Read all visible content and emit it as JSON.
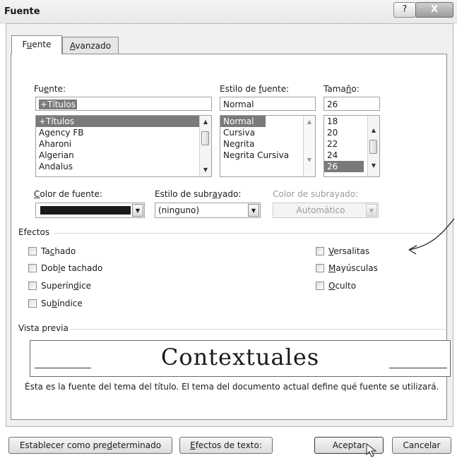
{
  "window": {
    "title": "Fuente",
    "help_label": "?",
    "close_label": "X"
  },
  "tabs": [
    {
      "label_pre": "F",
      "label_u": "u",
      "label_post": "ente"
    },
    {
      "label_pre": "",
      "label_u": "A",
      "label_post": "vanzado"
    }
  ],
  "font": {
    "label_pre": "Fu",
    "label_u": "e",
    "label_post": "nte:",
    "value": "+Títulos",
    "list": [
      "+Títulos",
      "Agency FB",
      "Aharoni",
      "Algerian",
      "Andalus"
    ]
  },
  "style": {
    "label_pre": "Estilo de ",
    "label_u": "f",
    "label_post": "uente:",
    "value": "Normal",
    "list": [
      "Normal",
      "Cursiva",
      "Negrita",
      "Negrita Cursiva"
    ]
  },
  "size": {
    "label_pre": "Tama",
    "label_u": "ñ",
    "label_post": "o:",
    "value": "26",
    "list": [
      "18",
      "20",
      "22",
      "24",
      "26"
    ]
  },
  "font_color": {
    "label_pre": "",
    "label_u": "C",
    "label_post": "olor de fuente:",
    "color": "#1a1a1a"
  },
  "underline_style": {
    "label_pre": "Estilo de subr",
    "label_u": "a",
    "label_post": "yado:",
    "value": "(ninguno)"
  },
  "underline_color": {
    "label": "Color de subrayado:",
    "value": "Automático"
  },
  "effects": {
    "title": "Efectos",
    "left": [
      {
        "pre": "Ta",
        "u": "c",
        "post": "hado"
      },
      {
        "pre": "Dob",
        "u": "l",
        "post": "e tachado"
      },
      {
        "pre": "Superín",
        "u": "d",
        "post": "ice"
      },
      {
        "pre": "Su",
        "u": "b",
        "post": "índice"
      }
    ],
    "right": [
      {
        "pre": "",
        "u": "V",
        "post": "ersalitas"
      },
      {
        "pre": "",
        "u": "M",
        "post": "ayúsculas"
      },
      {
        "pre": "",
        "u": "O",
        "post": "culto"
      }
    ]
  },
  "preview": {
    "title": "Vista previa",
    "sample": "Contextuales",
    "note": "Ésta es la fuente del tema del título. El tema del documento actual define qué fuente se utilizará."
  },
  "buttons": {
    "default": {
      "pre": "Establecer como pre",
      "u": "d",
      "post": "eterminado"
    },
    "text_effects": {
      "pre": "",
      "u": "E",
      "post": "fectos de texto:"
    },
    "ok": "Aceptar",
    "cancel": "Cancelar"
  }
}
